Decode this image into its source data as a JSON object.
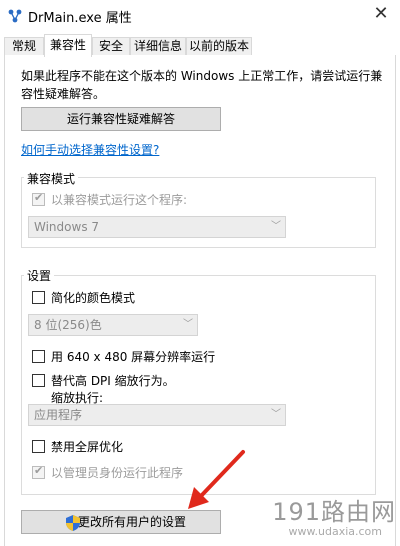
{
  "window": {
    "title": "DrMain.exe 属性",
    "close_glyph": "✕"
  },
  "tabs": [
    {
      "label": "常规",
      "active": false
    },
    {
      "label": "兼容性",
      "active": true
    },
    {
      "label": "安全",
      "active": false
    },
    {
      "label": "详细信息",
      "active": false
    },
    {
      "label": "以前的版本",
      "active": false
    }
  ],
  "intro_text": "如果此程序不能在这个版本的 Windows 上正常工作，请尝试运行兼容性疑难解答。",
  "troubleshooter_button": "运行兼容性疑难解答",
  "manual_link": "如何手动选择兼容性设置?",
  "compat_mode": {
    "group_label": "兼容模式",
    "checkbox_label": "以兼容模式运行这个程序:",
    "checked": true,
    "disabled": true,
    "os_select_value": "Windows 7"
  },
  "settings": {
    "group_label": "设置",
    "reduced_color": {
      "label": "简化的颜色模式",
      "checked": false
    },
    "color_select_value": "8 位(256)色",
    "res_640": {
      "label": "用 640 x 480 屏幕分辨率运行",
      "checked": false
    },
    "dpi_override": {
      "label": "替代高 DPI 缩放行为。",
      "sub_label": "缩放执行:",
      "checked": false
    },
    "dpi_select_value": "应用程序",
    "disable_fullscreen": {
      "label": "禁用全屏优化",
      "checked": false
    },
    "run_as_admin": {
      "label": "以管理员身份运行此程序",
      "checked": true,
      "disabled": true
    }
  },
  "all_users_button": "更改所有用户的设置",
  "watermark": {
    "brand": "191路由网",
    "url": "www.udaxia.com"
  },
  "colors": {
    "link": "#0066cc",
    "arrow": "#e0291c",
    "disabled_text": "#9c9c9c"
  }
}
